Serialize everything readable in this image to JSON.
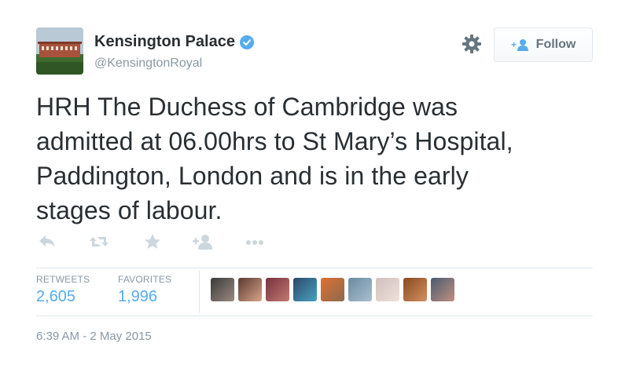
{
  "user": {
    "display_name": "Kensington Palace",
    "handle": "@KensingtonRoyal",
    "verified": true
  },
  "follow_button": {
    "label": "Follow"
  },
  "tweet": {
    "lines": [
      "HRH The Duchess of Cambridge was",
      "admitted at 06.00hrs to St Mary’s Hospital,",
      "Paddington, London and is in the early",
      "stages of labour."
    ]
  },
  "actions": [
    "reply-icon",
    "retweet-icon",
    "favorite-icon",
    "follow-icon",
    "more-icon"
  ],
  "stats": {
    "retweets_label": "RETWEETS",
    "retweets": "2,605",
    "favorites_label": "FAVORITES",
    "favorites": "1,996"
  },
  "favoriters": [
    "avatar-1",
    "avatar-2",
    "avatar-3",
    "avatar-4",
    "avatar-5",
    "avatar-6",
    "avatar-7",
    "avatar-8",
    "avatar-9"
  ],
  "timestamp": "6:39 AM - 2 May 2015",
  "colors": {
    "link": "#55acee",
    "muted": "#8899a6",
    "text": "#292f33"
  }
}
